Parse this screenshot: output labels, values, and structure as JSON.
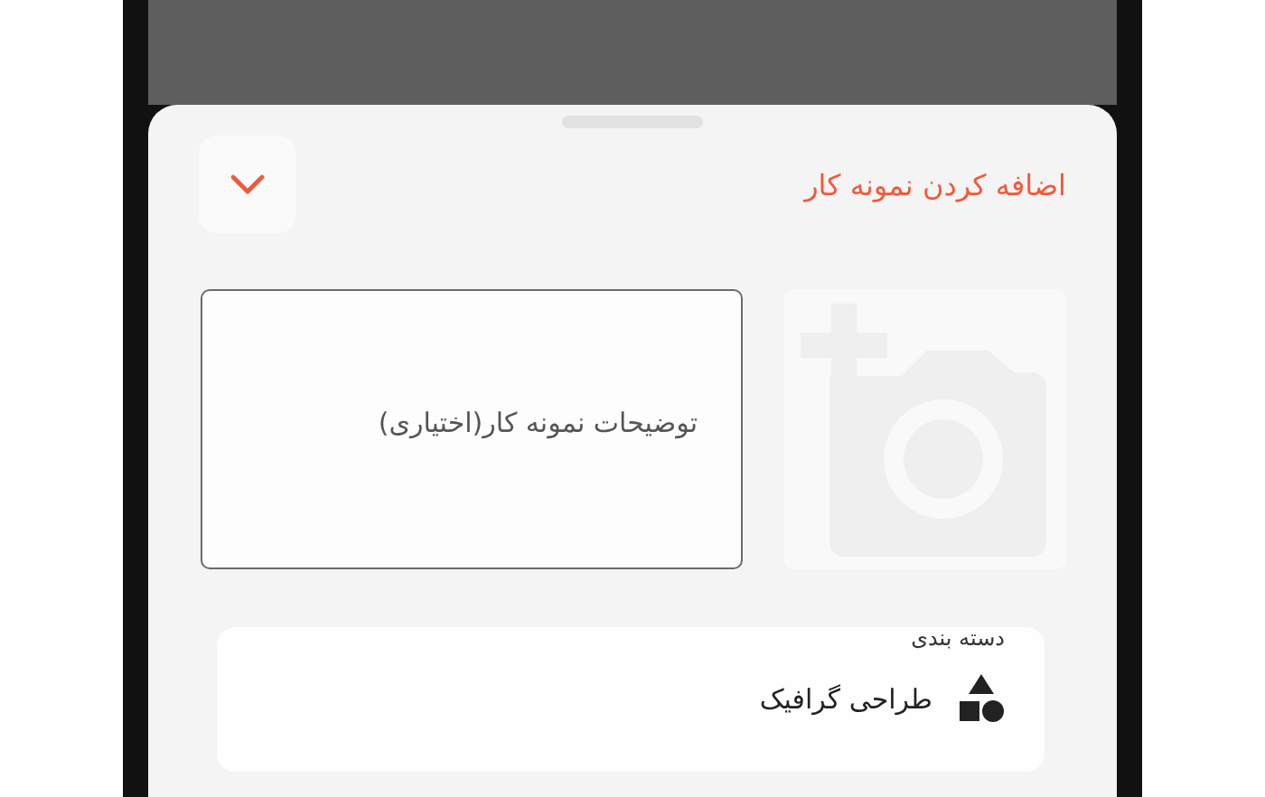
{
  "sheet": {
    "title": "اضافه کردن نمونه کار",
    "description_field": {
      "placeholder": "توضیحات نمونه کار(اختیاری)"
    },
    "category": {
      "label": "دسته بندی",
      "value": "طراحی گرافیک"
    }
  }
}
